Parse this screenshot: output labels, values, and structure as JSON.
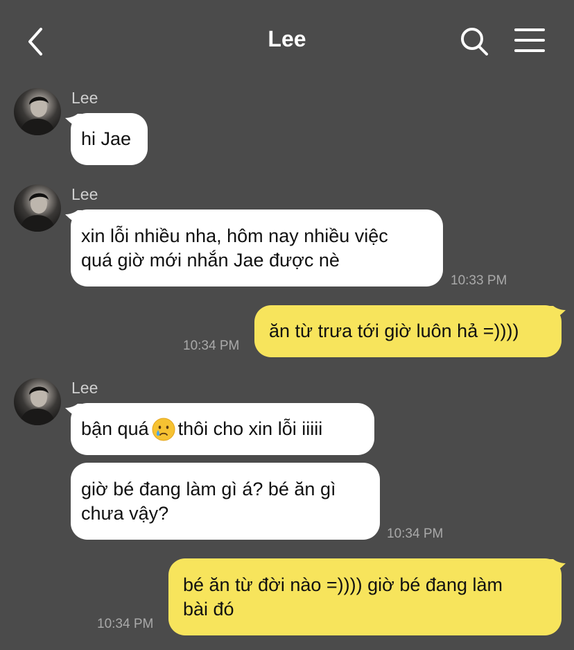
{
  "header": {
    "title": "Lee",
    "back_icon": "chevron-left-icon",
    "search_icon": "search-icon",
    "menu_icon": "menu-icon"
  },
  "colors": {
    "background": "#4b4b4b",
    "incoming_bubble": "#ffffff",
    "outgoing_bubble": "#f7e45c",
    "timestamp": "#a9a9a9"
  },
  "messages": [
    {
      "sender": "Lee",
      "direction": "incoming",
      "lines": [
        "hi Jae"
      ]
    },
    {
      "sender": "Lee",
      "direction": "incoming",
      "lines": [
        "xin lỗi nhiều nha, hôm nay nhiều việc",
        "quá giờ mới nhắn Jae được nè"
      ],
      "time": "10:33 PM"
    },
    {
      "direction": "outgoing",
      "lines": [
        "ăn từ trưa tới giờ luôn hả =))))"
      ],
      "time": "10:34 PM"
    },
    {
      "sender": "Lee",
      "direction": "incoming",
      "text_before_emoji": "bận quá",
      "emoji": "crying-face-emoji",
      "text_after_emoji": "thôi cho xin lỗi iiiii"
    },
    {
      "direction": "incoming",
      "lines": [
        "giờ bé đang làm gì á? bé ăn gì",
        "chưa vậy?"
      ],
      "time": "10:34 PM"
    },
    {
      "direction": "outgoing",
      "lines": [
        "bé ăn từ đời nào =)))) giờ bé đang làm",
        "bài đó"
      ],
      "time": "10:34 PM"
    }
  ]
}
